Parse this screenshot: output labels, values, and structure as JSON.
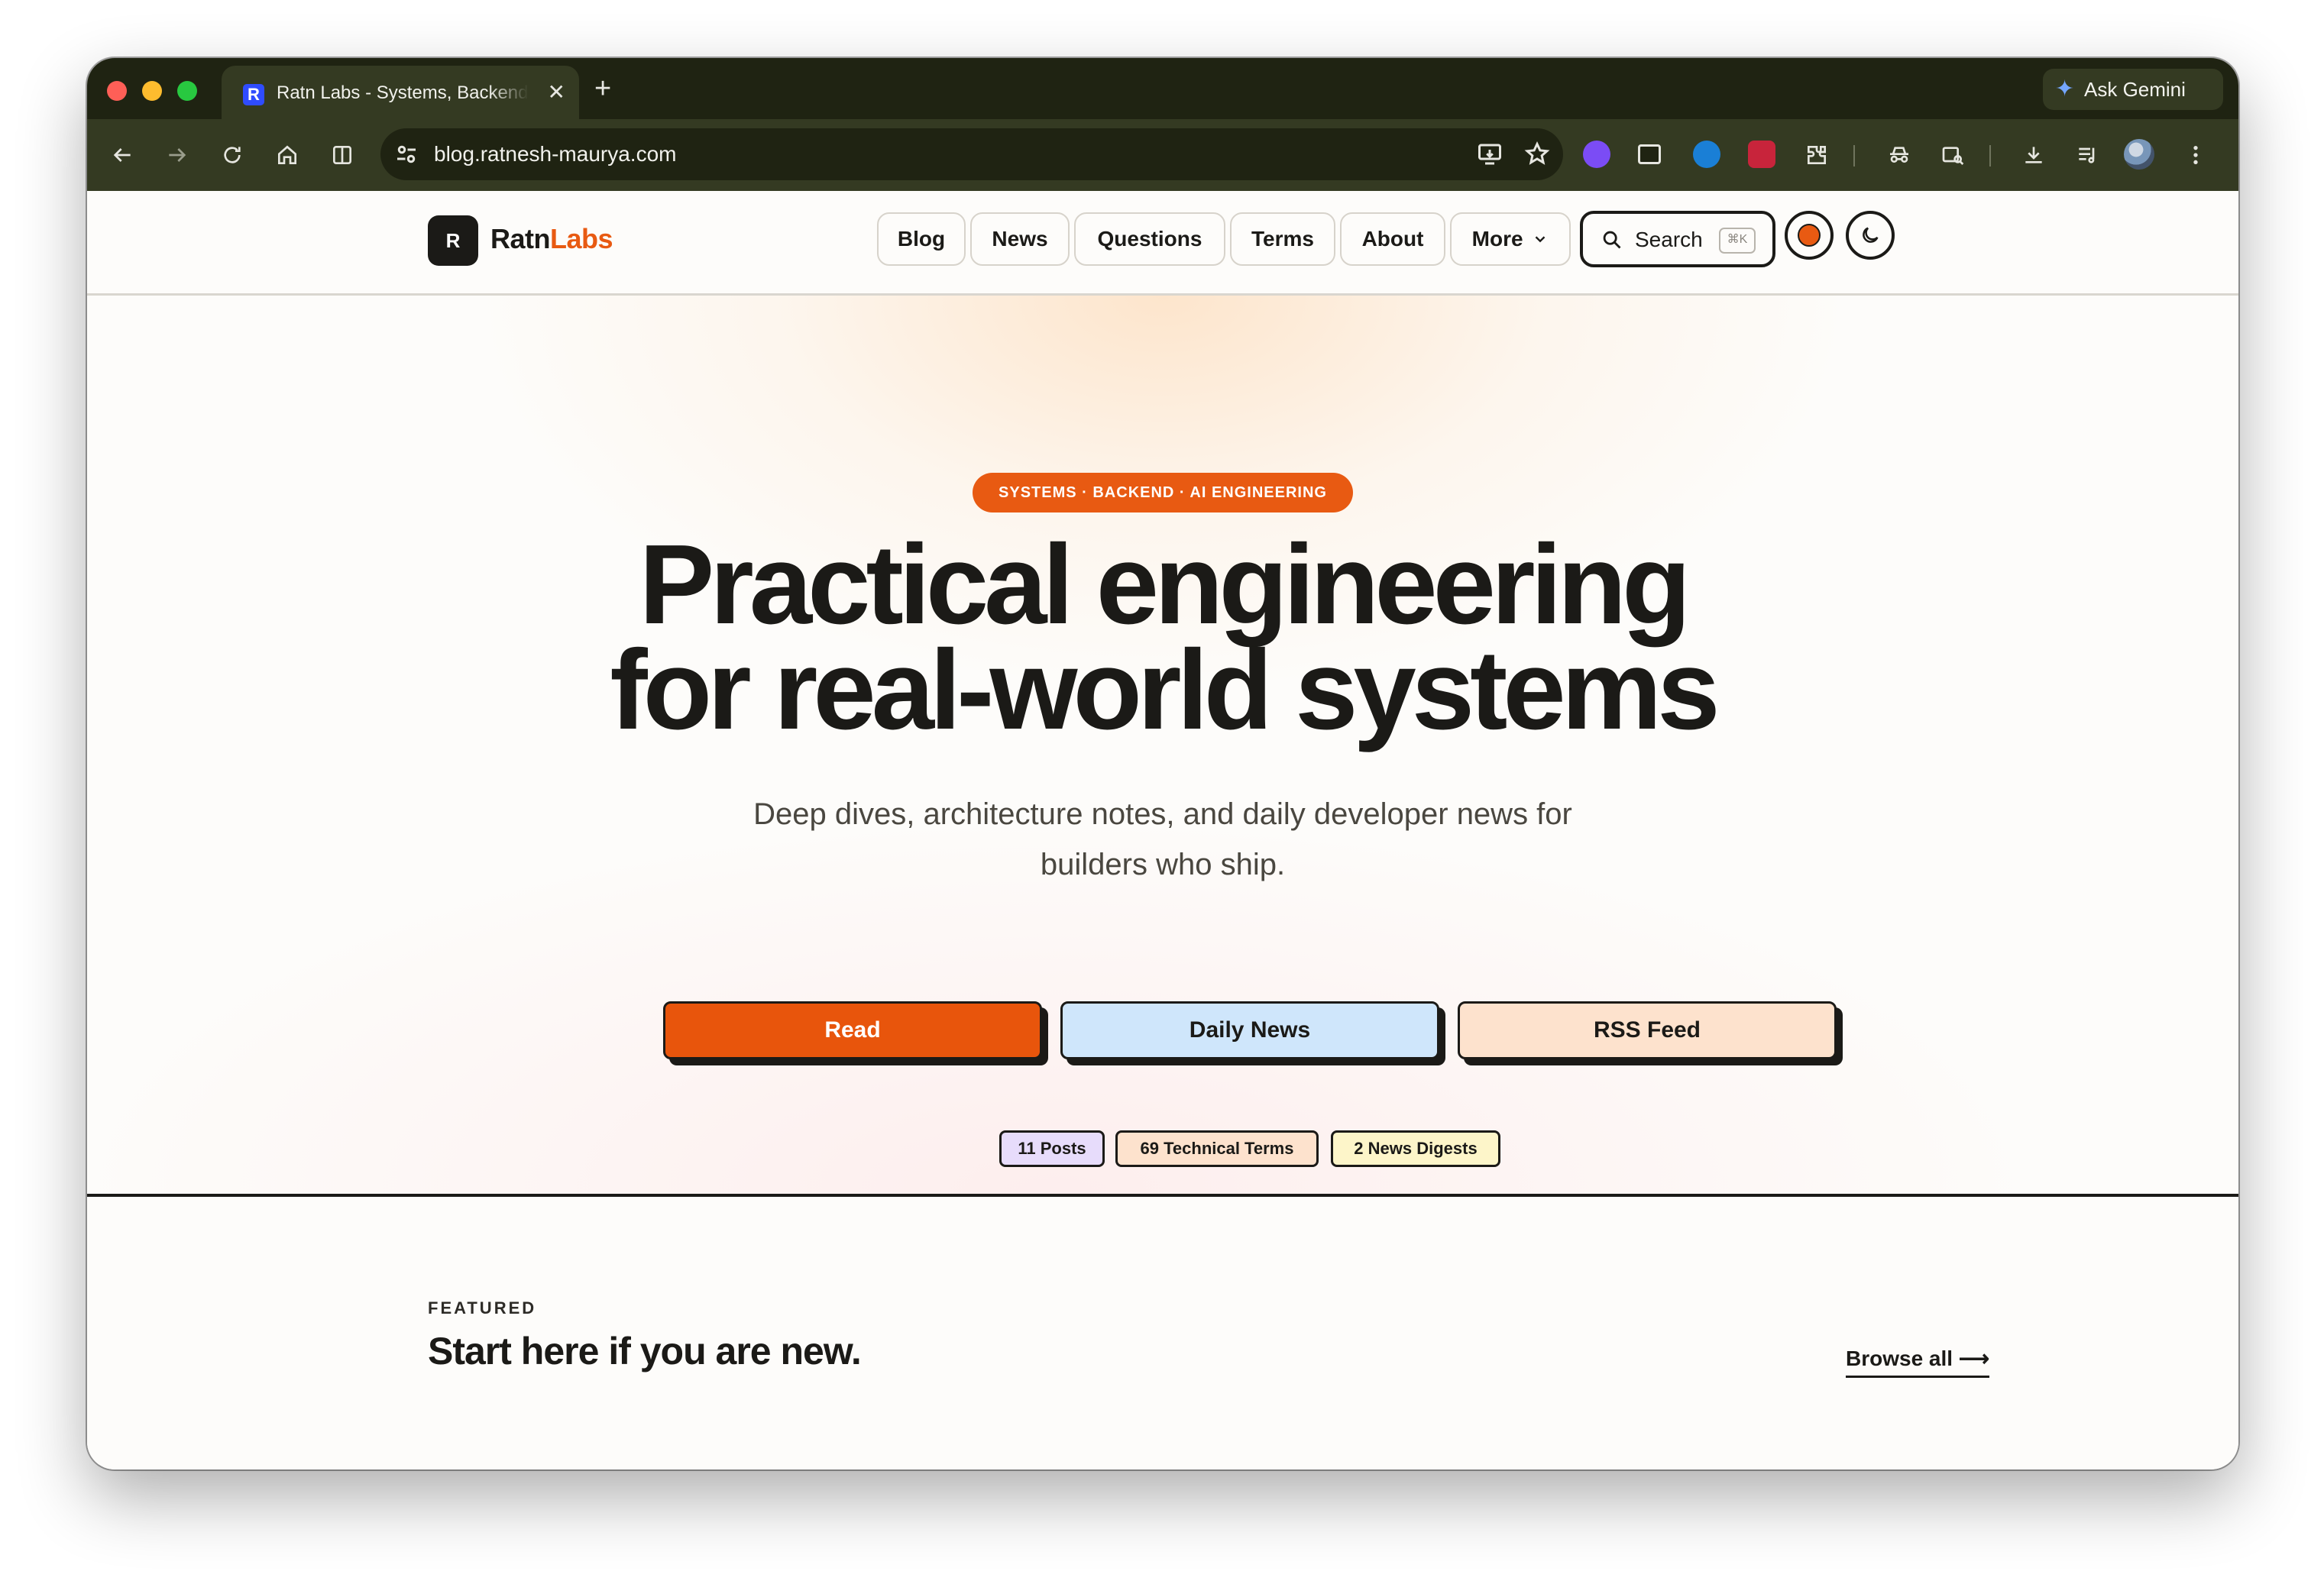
{
  "browser": {
    "tab_title": "Ratn Labs - Systems, Backend & AI Engineering",
    "tab_favicon": "R",
    "ask_gemini_label": "Ask Gemini",
    "url": "blog.ratnesh-maurya.com",
    "icons": [
      "back-arrow-icon",
      "forward-arrow-icon",
      "reload-icon",
      "home-icon",
      "split-view-icon",
      "site-settings-icon",
      "install-app-icon",
      "bookmark-star-icon",
      "extensions-icon",
      "downloads-icon",
      "media-controls-icon",
      "kebab-menu-icon"
    ]
  },
  "site": {
    "logo_mark": "R",
    "logo_text_a": "Ratn",
    "logo_text_b": "Labs",
    "nav": [
      {
        "label": "Blog"
      },
      {
        "label": "News"
      },
      {
        "label": "Questions"
      },
      {
        "label": "Terms"
      },
      {
        "label": "About"
      },
      {
        "label": "More"
      }
    ],
    "search_label": "Search",
    "search_shortcut": "⌘K",
    "accent_color": "#e85a12"
  },
  "hero": {
    "pill": "SYSTEMS · BACKEND · AI ENGINEERING",
    "title_line1": "Practical engineering",
    "title_line2": "for real-world systems",
    "subtitle": "Deep dives, architecture notes, and daily developer news for builders who ship.",
    "cta": [
      {
        "label": "Read"
      },
      {
        "label": "Daily News"
      },
      {
        "label": "RSS Feed"
      }
    ],
    "badges": [
      {
        "label": "11 Posts"
      },
      {
        "label": "69 Technical Terms"
      },
      {
        "label": "2 News Digests"
      }
    ]
  },
  "featured": {
    "label": "FEATURED",
    "title": "Start here if you are new.",
    "browse_all": "Browse all ⟶"
  }
}
